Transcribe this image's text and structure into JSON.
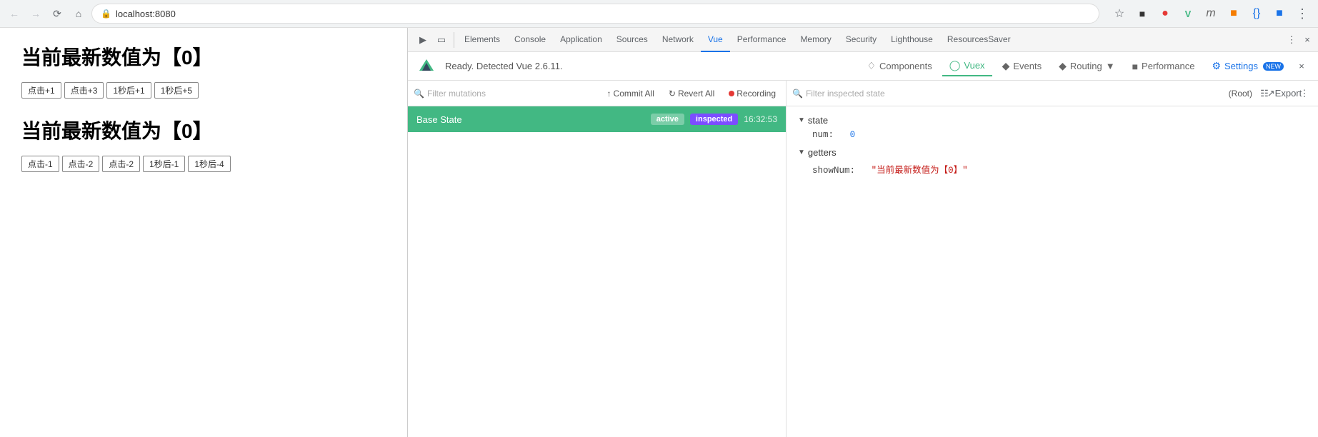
{
  "browser": {
    "url": "localhost:8080",
    "nav": {
      "back_disabled": true,
      "forward_disabled": true
    }
  },
  "page": {
    "heading1": "当前最新数值为【0】",
    "heading2": "当前最新数值为【0】",
    "group1_buttons": [
      "点击+1",
      "点击+3",
      "1秒后+1",
      "1秒后+5"
    ],
    "group2_buttons": [
      "点击-1",
      "点击-2",
      "点击-2",
      "1秒后-1",
      "1秒后-4"
    ]
  },
  "devtools": {
    "tabs": [
      "Elements",
      "Console",
      "Application",
      "Sources",
      "Network",
      "Vue",
      "Performance",
      "Memory",
      "Security",
      "Lighthouse",
      "ResourcesSaver"
    ],
    "active_tab": "Vue",
    "vue_status": "Ready. Detected Vue 2.6.11.",
    "vue_nav": [
      "Components",
      "Vuex",
      "Events",
      "Routing",
      "Performance",
      "Settings"
    ],
    "vue_nav_active": "Vuex",
    "mutations": {
      "search_placeholder": "Filter mutations",
      "commit_label": "Commit All",
      "revert_label": "Revert All",
      "recording_label": "Recording"
    },
    "base_state": {
      "label": "Base State",
      "badge_active": "active",
      "badge_inspected": "inspected",
      "time": "16:32:53"
    },
    "inspector": {
      "search_placeholder": "Filter inspected state",
      "root_label": "(Root)",
      "sections": {
        "state": {
          "label": "state",
          "entries": [
            {
              "key": "num:",
              "value": "0",
              "type": "num"
            }
          ]
        },
        "getters": {
          "label": "getters",
          "entries": [
            {
              "key": "showNum:",
              "value": "\"当前最新数值为【0】\"",
              "type": "str"
            }
          ]
        }
      }
    }
  }
}
